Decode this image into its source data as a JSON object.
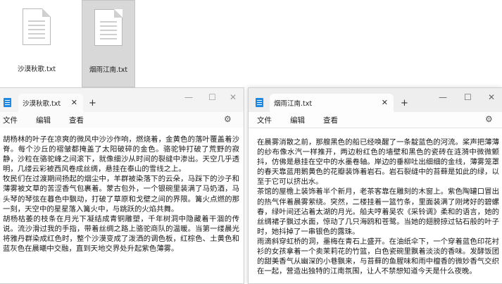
{
  "desktop": {
    "files": [
      {
        "label": "沙漠秋歌.txt"
      },
      {
        "label": "烟雨江南.txt"
      }
    ]
  },
  "left_window": {
    "tab_title": "沙漠秋歌.txt",
    "tab_close": "✕",
    "tab_add": "+",
    "menu": [
      "文件",
      "编辑",
      "查看"
    ],
    "controls": {
      "minimize": "—",
      "maximize": "☐",
      "close": "✕"
    },
    "paragraphs": [
      "胡杨林的叶子在凉爽的微风中沙沙作响，燃烧着，金黄色的落叶覆盖着沙脊。每个沙丘的褶皱都掩盖了太阳破碎的金色。骆驼钟打破了荒野的寂静，沙粒在骆驼峰之间滚下，就像细沙从时间的裂缝中渗出。天空几乎透明，几缕云彩被西风卷成丝绸，悬挂在泰山的雪线之上。",
      "牧民们在过渡期间扬起的烟尘中，羊群被染落下的云朵，马踩下的沙子和薄雾被文草的苦涩香气包裹着。蒙古包外，一个银碗里装满了马奶酒，马头琴的琴弦在暮色中飘动，打破了草原和戈壁之间的界限。篝火点燃的那一刻，天空中的星星落入篝火中，与跳跃的火焰共舞。",
      "胡杨枯萎的枝条在月光下凝结成青铜雕塑，千年树洞中隐藏着干涸的传说。流沙滑过我的手指，带着丝绸之路上骆驼商队的温暖。当第一缕晨光将雅丹群染成红色时，整个沙漠变成了泼洒的调色板，红棕色、土黄色和蓝灰色在晨曦中交融，直到天地交界处升起紫色薄雾。"
    ]
  },
  "right_window": {
    "tab_title": "烟雨江南.txt",
    "tab_close": "✕",
    "tab_add": "+",
    "menu": [
      "文件",
      "编辑",
      "查看"
    ],
    "controls": {
      "minimize": "—",
      "maximize": "☐",
      "close": "✕"
    },
    "paragraphs": [
      "在晨雾消散之前，那艘黑色的船已经唤醒了一条靛蓝色的河流。桨声把薄薄的纱布像水汽一样推开，两边粉红色的墙壁和黑色的瓷砖在涟漪中微微颤抖，仿佛是悬挂在空中的水墨卷轴。岸边的垂柳吐出细细的金线，薄雾笼罩的春天靠蓝用鹅黄色的花瓣装饰着岩石。岩石裂缝中的苔藓是如此的绿，以至于它可以挤出水。",
      "茶馆的屋檐上装饰着半个新月，老茶客靠在雕刻的木窗上。紫色陶罐口冒出的热气伴着晨雾萦绕。突然，二楼挂着一篮竹条，里面装满了刚烤好的碧螺春，绿叶间还沾着太湖的月光。船夫哼着吴农《采铃调》柔和的语言，她的丝绸裙子飘过水面，惊动了几只海鸥和苍鹭。当她的翅膀掠过钻石般的叶子时，她抖掉了一串银色的露珠。",
      "雨滴斜穿虹桥的洞，墨梅在青石上盛开。在油纸伞下，一个穿着蓝色印花衬衫的女孩拿着一个卖茉莉花的竹篮，白色瓷碗里飘着淡淡的香味。发酵饭团的甜美香气从幽深的小巷飘来，与苔藓的鱼腥味和雨中檀香的微妙香气交织在一起，营造出独特的江南氛围，让人不禁想知道今天是什么夜晚。"
    ]
  }
}
